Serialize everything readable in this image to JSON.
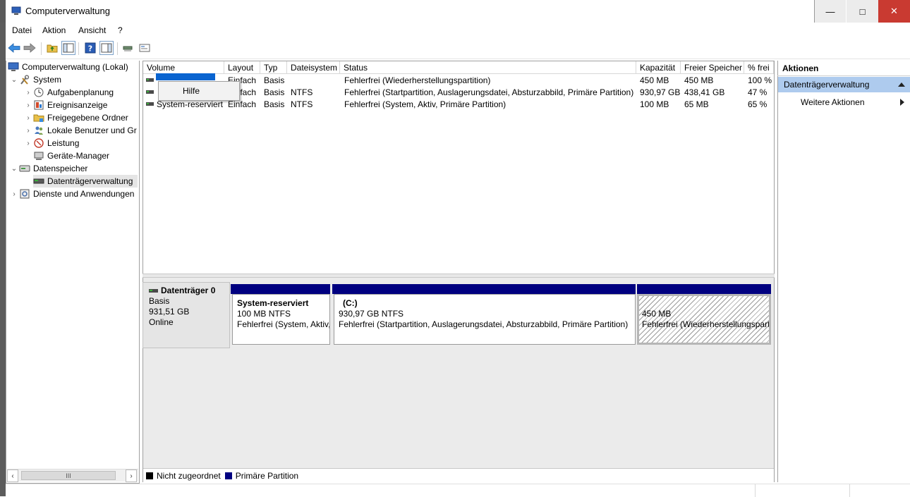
{
  "window": {
    "title": "Computerverwaltung",
    "min_symbol": "—",
    "max_symbol": "□",
    "close_symbol": "✕"
  },
  "menu": [
    "Datei",
    "Aktion",
    "Ansicht",
    "?"
  ],
  "tree": {
    "root": "Computerverwaltung (Lokal)",
    "system": "System",
    "aufgabenplanung": "Aufgabenplanung",
    "ereignisanzeige": "Ereignisanzeige",
    "freigegebene": "Freigegebene Ordner",
    "lokale": "Lokale Benutzer und Gr",
    "leistung": "Leistung",
    "geraete": "Geräte-Manager",
    "datenspeicher": "Datenspeicher",
    "datentraeger": "Datenträgerverwaltung",
    "dienste": "Dienste und Anwendungen",
    "scroll_thumb": "III"
  },
  "volume_table": {
    "headers": [
      "Volume",
      "Layout",
      "Typ",
      "Dateisystem",
      "Status",
      "Kapazität",
      "Freier Speicher",
      "% frei"
    ],
    "rows": [
      [
        "",
        "Einfach",
        "Basis",
        "",
        "Fehlerfrei (Wiederherstellungspartition)",
        "450 MB",
        "450 MB",
        "100 %"
      ],
      [
        "",
        "Einfach",
        "Basis",
        "NTFS",
        "Fehlerfrei (Startpartition, Auslagerungsdatei, Absturzabbild, Primäre Partition)",
        "930,97 GB",
        "438,41 GB",
        "47 %"
      ],
      [
        "System-reserviert",
        "Einfach",
        "Basis",
        "NTFS",
        "Fehlerfrei (System, Aktiv, Primäre Partition)",
        "100 MB",
        "65 MB",
        "65 %"
      ]
    ]
  },
  "context_menu": {
    "item": "Hilfe"
  },
  "disk": {
    "name": "Datenträger 0",
    "type": "Basis",
    "size": "931,51 GB",
    "state": "Online",
    "partitions": [
      {
        "title": "System-reserviert",
        "size": "100 MB NTFS",
        "status": "Fehlerfrei (System, Aktiv,"
      },
      {
        "title": "(C:)",
        "size": "930,97 GB NTFS",
        "status": "Fehlerfrei (Startpartition, Auslagerungsdatei, Absturzabbild, Primäre Partition)"
      },
      {
        "title": "",
        "size": "450 MB",
        "status": "Fehlerfrei (Wiederherstellungspart"
      }
    ]
  },
  "legend": {
    "unallocated": "Nicht zugeordnet",
    "primary": "Primäre Partition",
    "unallocated_color": "#000000",
    "primary_color": "#000080"
  },
  "actions": {
    "title": "Aktionen",
    "section": "Datenträgerverwaltung",
    "more": "Weitere Aktionen"
  }
}
